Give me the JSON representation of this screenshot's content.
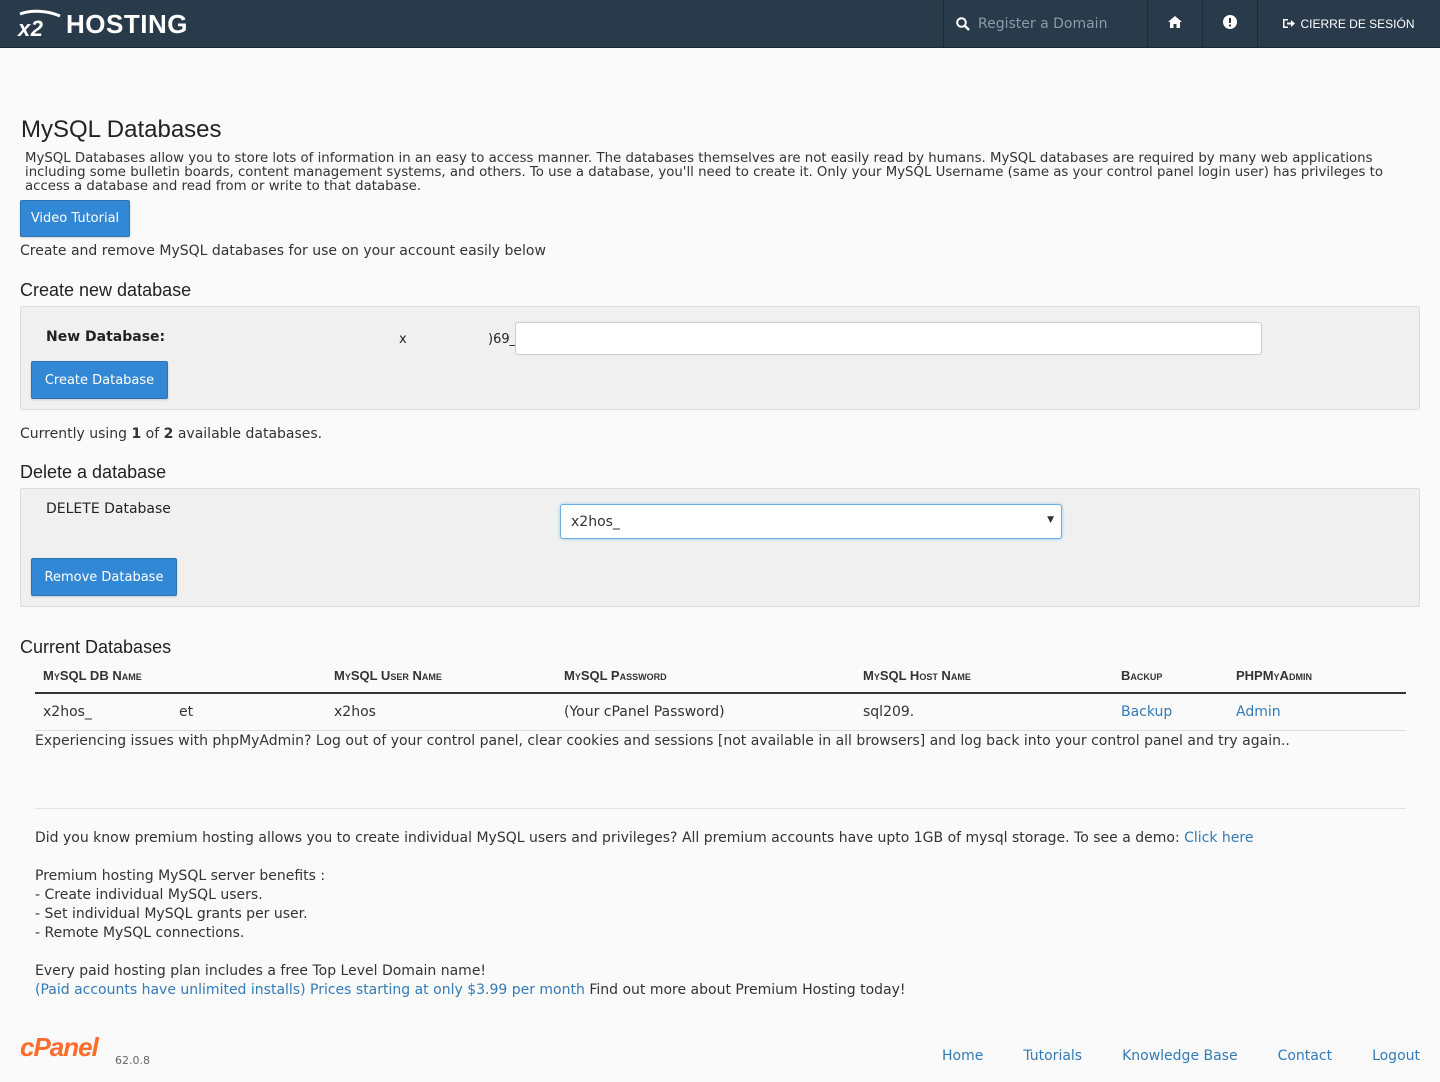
{
  "header": {
    "logo_text": "HOSTING",
    "search_placeholder": "Register a Domain",
    "logout_label": "CIERRE DE SESIÓN"
  },
  "page": {
    "title": "MySQL Databases",
    "description": "MySQL Databases allow you to store lots of information in an easy to access manner. The databases themselves are not easily read by humans. MySQL databases are required by many web applications including some bulletin boards, content management systems, and others. To use a database, you'll need to create it. Only your MySQL Username (same as your control panel login user) has privileges to access a database and read from or write to that database.",
    "video_button": "Video Tutorial",
    "subtitle": "Create and remove MySQL databases for use on your account easily below"
  },
  "create": {
    "heading": "Create new database",
    "label": "New Database:",
    "prefix_a": "x",
    "prefix_b": ")69_",
    "input_value": "",
    "button": "Create Database"
  },
  "usage": {
    "before": "Currently using ",
    "used": "1",
    "middle": " of ",
    "total": "2",
    "after": " available databases."
  },
  "delete": {
    "heading": "Delete a database",
    "label": "DELETE Database",
    "selected": "x2hos_",
    "button": "Remove Database"
  },
  "current": {
    "heading": "Current Databases",
    "columns": [
      "MySQL DB Name",
      "MySQL User Name",
      "MySQL Password",
      "MySQL Host Name",
      "Backup",
      "PHPMyAdmin"
    ],
    "rows": [
      {
        "db_name_a": "x2hos_",
        "db_name_b": "et",
        "user": "x2hos",
        "password": "(Your cPanel Password)",
        "host": "sql209.",
        "backup": "Backup",
        "admin": "Admin"
      }
    ],
    "issue": "Experiencing issues with phpMyAdmin? Log out of your control panel, clear cookies and sessions [not available in all browsers] and log back into your control panel and try again.."
  },
  "promo": {
    "line1": "Did you know premium hosting allows you to create individual MySQL users and privileges? All premium accounts have upto 1GB of mysql storage. To see a demo: ",
    "line1_link": "Click here",
    "benefits_title": "Premium hosting MySQL server benefits :",
    "benefits": [
      "- Create individual MySQL users.",
      "- Set individual MySQL grants per user.",
      "- Remote MySQL connections."
    ],
    "tld": "Every paid hosting plan includes a free Top Level Domain name!",
    "link_text": "(Paid accounts have unlimited installs) Prices starting at only $3.99 per month",
    "after_link": " Find out more about Premium Hosting today!"
  },
  "footer": {
    "logo": "cPanel",
    "version": "62.0.8",
    "links": [
      "Home",
      "Tutorials",
      "Knowledge Base",
      "Contact",
      "Logout"
    ]
  },
  "colors": {
    "topbar": "#293a4a",
    "primary_button": "#3288d4",
    "link": "#337ab7",
    "cpanel_orange": "#ff6c2c"
  }
}
